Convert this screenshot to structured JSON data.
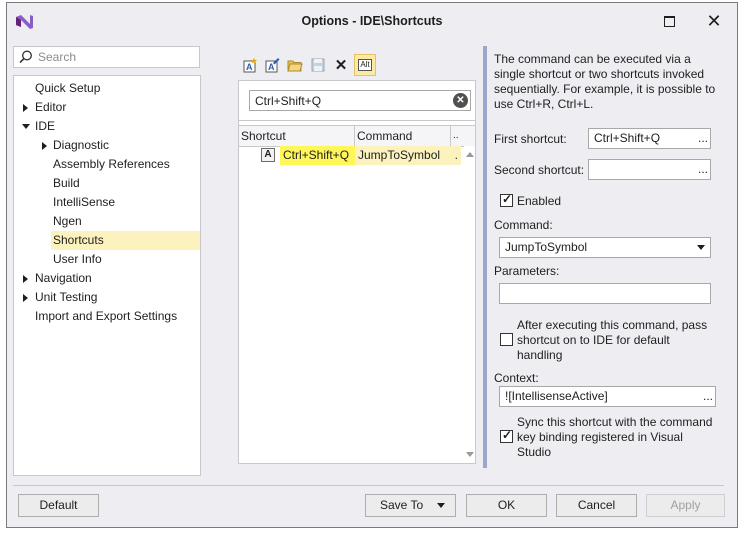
{
  "window": {
    "title": "Options - IDE\\Shortcuts"
  },
  "search": {
    "placeholder": "Search"
  },
  "tree": {
    "items": [
      {
        "label": "Quick Setup"
      },
      {
        "label": "Editor"
      },
      {
        "label": "IDE"
      },
      {
        "label": "Diagnostic"
      },
      {
        "label": "Assembly References"
      },
      {
        "label": "Build"
      },
      {
        "label": "IntelliSense"
      },
      {
        "label": "Ngen"
      },
      {
        "label": "Shortcuts",
        "selected": true
      },
      {
        "label": "User Info"
      },
      {
        "label": "Navigation"
      },
      {
        "label": "Unit Testing"
      },
      {
        "label": "Import and Export Settings"
      }
    ]
  },
  "toolbar": {
    "icons": [
      "add-shortcut-icon",
      "edit-shortcut-icon",
      "open-folder-icon",
      "save-icon",
      "delete-icon",
      "alt-toggle-icon"
    ],
    "alt_label": "Alt"
  },
  "filter": {
    "value": "Ctrl+Shift+Q"
  },
  "grid": {
    "headers": [
      "Shortcut",
      "Command",
      ".."
    ],
    "rows": [
      {
        "icon_letter": "A",
        "shortcut": "Ctrl+Shift+Q",
        "command": "JumpToSymbol",
        "extra": "."
      }
    ]
  },
  "details": {
    "description": "The command can be executed via a single shortcut or two shortcuts invoked sequentially. For example, it is possible to use Ctrl+R, Ctrl+L.",
    "first_shortcut_label": "First shortcut:",
    "first_shortcut_value": "Ctrl+Shift+Q",
    "second_shortcut_label": "Second shortcut:",
    "second_shortcut_value": "",
    "ellipsis": "...",
    "enabled_label": "Enabled",
    "enabled_checked": true,
    "command_label": "Command:",
    "command_value": "JumpToSymbol",
    "parameters_label": "Parameters:",
    "parameters_value": "",
    "pass_label": "After executing this command, pass shortcut on to IDE for default handling",
    "pass_checked": false,
    "context_label": "Context:",
    "context_value": "![IntellisenseActive]",
    "sync_label": "Sync this shortcut with the command key binding registered in Visual Studio",
    "sync_checked": true
  },
  "buttons": {
    "default": "Default",
    "save_to": "Save To",
    "ok": "OK",
    "cancel": "Cancel",
    "apply": "Apply"
  }
}
